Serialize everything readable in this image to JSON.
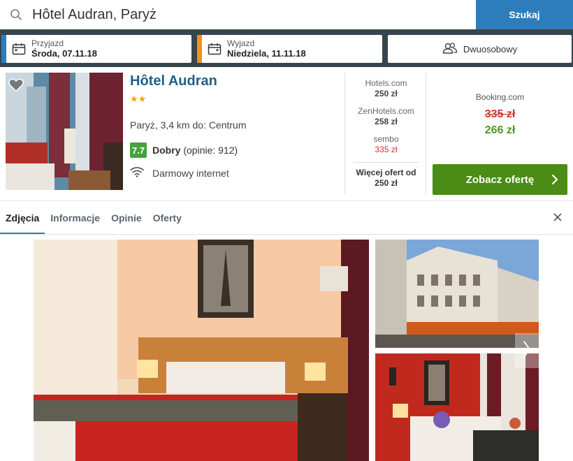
{
  "search": {
    "query": "Hôtel Audran, Paryż",
    "button_label": "Szukaj"
  },
  "checkin": {
    "label": "Przyjazd",
    "value": "Środa, 07.11.18",
    "accent": "#2d7dbc"
  },
  "checkout": {
    "label": "Wyjazd",
    "value": "Niedziela, 11.11.18",
    "accent": "#f0911e"
  },
  "guests": {
    "label": "Dwuosobowy"
  },
  "hotel": {
    "name": "Hôtel Audran",
    "stars": "★★",
    "star_count": 2,
    "location": "Paryż, 3,4 km do: Centrum",
    "rating_score": "7.7",
    "rating_label": "Dobry",
    "rating_reviews": "(opinie: 912)",
    "amenity": "Darmowy internet"
  },
  "prices": [
    {
      "site": "Hotels.com",
      "price": "250 zł"
    },
    {
      "site": "ZenHotels.com",
      "price": "258 zł"
    },
    {
      "site": "sembo",
      "price": "335 zł"
    }
  ],
  "more_offers": {
    "line1": "Więcej ofert od",
    "line2": "250 zł"
  },
  "best_deal": {
    "site": "Booking.com",
    "old_price": "335 zł",
    "new_price": "266 zł",
    "button_label": "Zobacz ofertę"
  },
  "tabs": [
    {
      "label": "Zdjęcia",
      "active": true
    },
    {
      "label": "Informacje",
      "active": false
    },
    {
      "label": "Opinie",
      "active": false
    },
    {
      "label": "Oferty",
      "active": false
    }
  ],
  "colors": {
    "header_bg": "#37454d",
    "search_button": "#2d7dbc",
    "offer_button": "#4a8c16",
    "price_green": "#4a9a1c",
    "price_red": "#d0342c",
    "rating_badge": "#42a43d",
    "hotel_name": "#1f5f8c"
  }
}
